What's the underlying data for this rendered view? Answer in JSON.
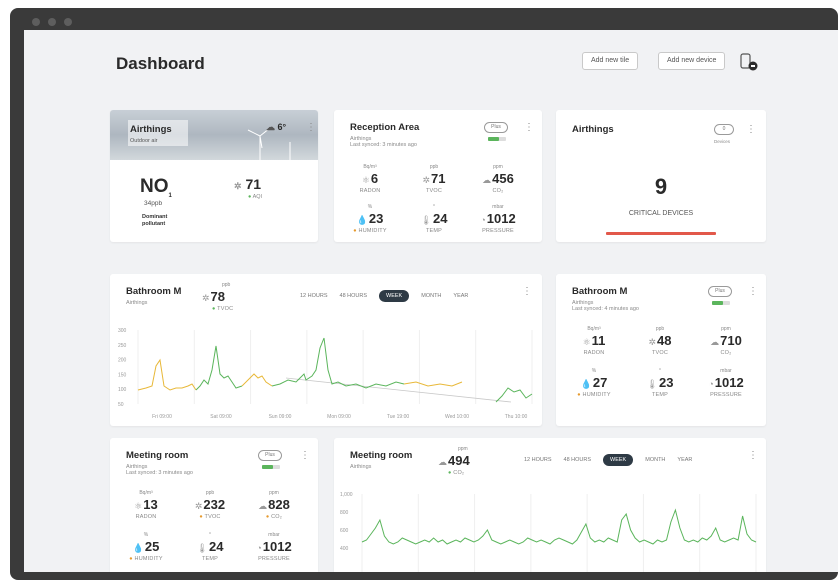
{
  "header": {
    "title": "Dashboard",
    "add_tile": "Add new tile",
    "add_device": "Add new device"
  },
  "outdoor": {
    "title": "Airthings",
    "subtitle": "Outdoor air",
    "temp": "6°",
    "no_sub": "1",
    "no_unit": "34ppb",
    "dominant_1": "Dominant",
    "dominant_2": "pollutant",
    "aqi_value": "71",
    "aqi_label": "AQI"
  },
  "reception": {
    "title": "Reception Area",
    "sub1": "Airthings",
    "sub2": "Last synced: 3 minutes ago",
    "pill": "Plus",
    "metrics": [
      {
        "unit": "Bq/m³",
        "value": "6",
        "label": "RADON"
      },
      {
        "unit": "ppb",
        "value": "71",
        "label": "TVOC"
      },
      {
        "unit": "ppm",
        "value": "456",
        "label": "CO₂"
      },
      {
        "unit": "%",
        "value": "23",
        "label": "HUMIDITY",
        "dot": "#e69a2e"
      },
      {
        "unit": "°",
        "value": "24",
        "label": "TEMP"
      },
      {
        "unit": "mbar",
        "value": "1012",
        "label": "PRESSURE"
      }
    ]
  },
  "critical": {
    "title": "Airthings",
    "pill": "0",
    "pill_sub": "Devices",
    "count": "9",
    "label": "CRITICAL DEVICES",
    "bar_color": "#e2584a"
  },
  "bathroom_chart": {
    "title": "Bathroom M",
    "sub": "Airthings",
    "metric_unit": "ppb",
    "metric_value": "78",
    "metric_label": "TVOC",
    "tabs": [
      "12 HOURS",
      "48 HOURS",
      "WEEK",
      "MONTH",
      "YEAR"
    ],
    "active_tab": "WEEK",
    "y_ticks": [
      "300",
      "250",
      "200",
      "150",
      "100",
      "50"
    ],
    "x_ticks": [
      "Fri 09:00",
      "Sat 09:00",
      "Sun 09:00",
      "Mon 09:00",
      "Tue 19:00",
      "Wed 10:00",
      "Thu 10:00"
    ],
    "colors": {
      "yellow": "#e8b838",
      "green": "#5bb55c"
    }
  },
  "bathroom_card": {
    "title": "Bathroom M",
    "sub1": "Airthings",
    "sub2": "Last synced: 4 minutes ago",
    "pill": "Plus",
    "metrics": [
      {
        "unit": "Bq/m³",
        "value": "11",
        "label": "RADON"
      },
      {
        "unit": "ppb",
        "value": "48",
        "label": "TVOC"
      },
      {
        "unit": "ppm",
        "value": "710",
        "label": "CO₂"
      },
      {
        "unit": "%",
        "value": "27",
        "label": "HUMIDITY",
        "dot": "#e69a2e"
      },
      {
        "unit": "°",
        "value": "23",
        "label": "TEMP"
      },
      {
        "unit": "mbar",
        "value": "1012",
        "label": "PRESSURE"
      }
    ]
  },
  "meeting_card": {
    "title": "Meeting room",
    "sub1": "Airthings",
    "sub2": "Last synced: 3 minutes ago",
    "pill": "Plus",
    "metrics": [
      {
        "unit": "Bq/m³",
        "value": "13",
        "label": "RADON"
      },
      {
        "unit": "ppb",
        "value": "232",
        "label": "TVOC",
        "dot": "#e69a2e"
      },
      {
        "unit": "ppm",
        "value": "828",
        "label": "CO₂",
        "dot": "#e69a2e"
      },
      {
        "unit": "%",
        "value": "25",
        "label": "HUMIDITY",
        "dot": "#e69a2e"
      },
      {
        "unit": "°",
        "value": "24",
        "label": "TEMP"
      },
      {
        "unit": "mbar",
        "value": "1012",
        "label": "PRESSURE"
      }
    ]
  },
  "meeting_chart": {
    "title": "Meeting room",
    "sub": "Airthings",
    "metric_unit": "ppm",
    "metric_value": "494",
    "metric_label": "CO₂",
    "tabs": [
      "12 HOURS",
      "48 HOURS",
      "WEEK",
      "MONTH",
      "YEAR"
    ],
    "active_tab": "WEEK",
    "y_ticks": [
      "1,000",
      "800",
      "600",
      "400"
    ],
    "color": "#5bb55c"
  }
}
